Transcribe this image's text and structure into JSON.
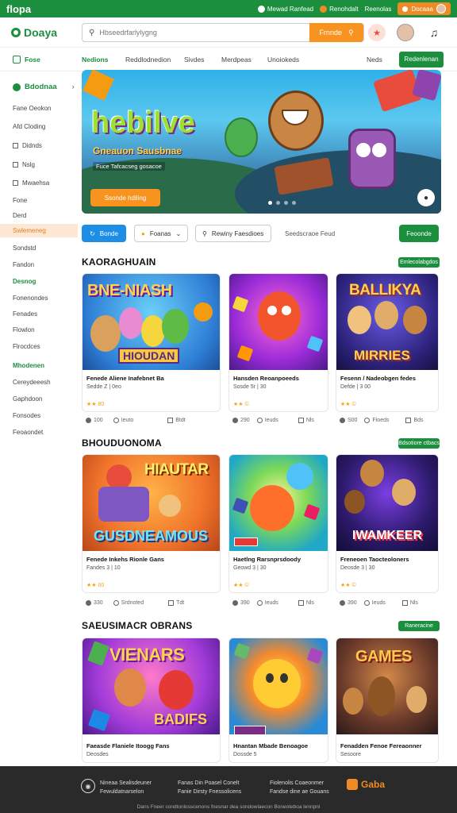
{
  "topbar": {
    "brand": "flopa",
    "links": [
      "Mewad Ranfead",
      "Renohdalt",
      "Reenolas"
    ],
    "pill_label": "Docaaa"
  },
  "header": {
    "logo_text": "Doaya",
    "search_placeholder": "Hbseedrfarlylygng",
    "search_button": "Frnnde"
  },
  "nav": {
    "home_label": "Fose",
    "tabs": [
      "Nedions",
      "Reddlodnedion",
      "Sivdes",
      "Merdpeas",
      "Unoiokeds"
    ],
    "right_link": "Neds",
    "button": "Redenlenan"
  },
  "sidebar": {
    "header": "Bdodnaa",
    "items": [
      "Fane Oeokon",
      "Afd Cloding",
      "Didnds",
      "Nslg",
      "Mwaehsa",
      "Fone",
      "Derd",
      "Swlemeneg",
      "Sondstd",
      "Fandon"
    ],
    "highlight_index": 7,
    "section1": "Desnog",
    "items2": [
      "Fonenondes",
      "Fenades",
      "Flowlon",
      "Flrocdces"
    ],
    "section2": "Mhodenen",
    "items3": [
      "Cereydeeesh",
      "Gaphdoon",
      "Fonsodes",
      "Feoaondet"
    ]
  },
  "hero": {
    "title": "hebilve",
    "subtitle": "Gneauon Sausbnae",
    "tagline": "Fuce Tafcacseg gosacoe",
    "button": "Ssonde hdiling"
  },
  "filters": {
    "primary": "Bonde",
    "option1": "Foanas",
    "option2": "Rewiny Faesdioes",
    "text": "Seedscraoe Feud",
    "button": "Feoonde"
  },
  "sections": [
    {
      "title": "KAORAGHUAIN",
      "badge": "Emlecolabgdos",
      "cards": [
        {
          "art_top": "BNE-NIASH",
          "art_bottom": "HIOUDAN",
          "title": "Fenede Aliene Inafebnet Ba",
          "sub": "Sedde Z | 0eo",
          "stars": "★★ 80",
          "stats": [
            "100",
            "Ieuto",
            "Btdt"
          ]
        },
        {
          "art_top": "",
          "art_bottom": "",
          "title": "Hansden Reoanpoeeds",
          "sub": "Sosde 5r | 30",
          "stars": "★★ ©",
          "stats": [
            "290",
            "Ieuds",
            "Nls"
          ]
        },
        {
          "art_top": "BALLIKYA",
          "art_bottom": "MIRRIES",
          "title": "Fesenn / Nadeobgen fedes",
          "sub": "Defde | 3 00",
          "stars": "★★ ©",
          "stats": [
            "S00",
            "Fioeds",
            "Bds"
          ]
        }
      ]
    },
    {
      "title": "BHOUDUONOMA",
      "badge": "Bdsotiore ctbacs",
      "cards": [
        {
          "art_top": "HIAUTAR",
          "art_bottom": "GUSDNEAMOUS",
          "title": "Fenede Inkehs Rionle Gans",
          "sub": "Fandes 3 | 10",
          "stars": "★★ 00",
          "stats": [
            "330",
            "Srdnoted",
            "Tdt"
          ]
        },
        {
          "art_top": "",
          "art_bottom": "",
          "title": "Haetlng Rarsnprsdoody",
          "sub": "Geowd 3 | 30",
          "stars": "★★ ©",
          "stats": [
            "390",
            "Ieuds",
            "Nls"
          ]
        },
        {
          "art_top": "",
          "art_bottom": "IWAMKEER",
          "title": "Freneoen Taocteoloners",
          "sub": "Deosde 3 | 30",
          "stars": "★★ ©",
          "stats": [
            "390",
            "Ieuds",
            "Nls"
          ]
        }
      ]
    },
    {
      "title": "SAEUSIMACR OBRANS",
      "badge": "Raneracine",
      "cards": [
        {
          "art_top": "VIENARS",
          "art_bottom": "BADIFS",
          "title": "Faeasde Flaniele Itoogg Fans",
          "sub": "Deosdes",
          "stars": "",
          "stats": []
        },
        {
          "art_top": "",
          "art_bottom": "",
          "title": "Hnantan Mbade Benoagoe",
          "sub": "Dossde 5",
          "stars": "",
          "stats": []
        },
        {
          "art_top": "GAMES",
          "art_bottom": "",
          "title": "Fenadden Fenoe Fereaonner",
          "sub": "Sesoore",
          "stars": "",
          "stats": []
        }
      ]
    }
  ],
  "footer": {
    "col1": [
      "Nineaa Sealisdeuner",
      "Fewuldatnarselon"
    ],
    "col2": [
      "Fanas Din Poasel Conelt",
      "Fanie Dirsty Fnessolicens"
    ],
    "col3": [
      "Fiolenolis Coaeonmer",
      "Fandse dine ae Gouans"
    ],
    "logo": "Gaba",
    "copyright": "Dans Fneer condtonlosscenons fnesnar dea sondowlaecon Boneoteboa lennpnl"
  },
  "colors": {
    "brand_green": "#1c8f3f",
    "accent_orange": "#f7931e",
    "filter_blue": "#1d8ee6",
    "sidebar_highlight": "#fde8d5"
  }
}
